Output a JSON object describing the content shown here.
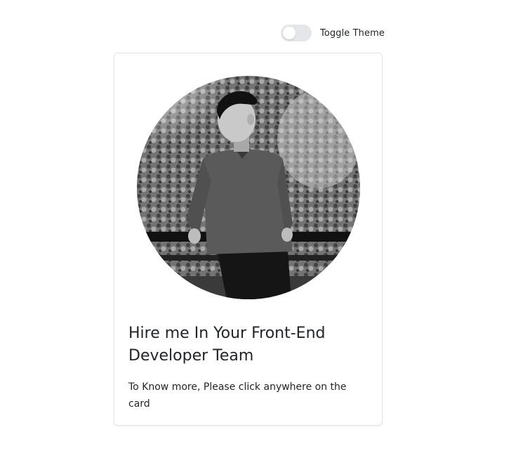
{
  "theme_toggle": {
    "label": "Toggle Theme",
    "checked": false
  },
  "card": {
    "image_icon": "profile-photo",
    "title": "Hire me In Your Front-End Developer Team",
    "text": "To Know more, Please click anywhere on the card"
  },
  "colors": {
    "text": "#212529",
    "toggle_track": "#e4e6e9",
    "card_border": "#e2e4e7"
  }
}
